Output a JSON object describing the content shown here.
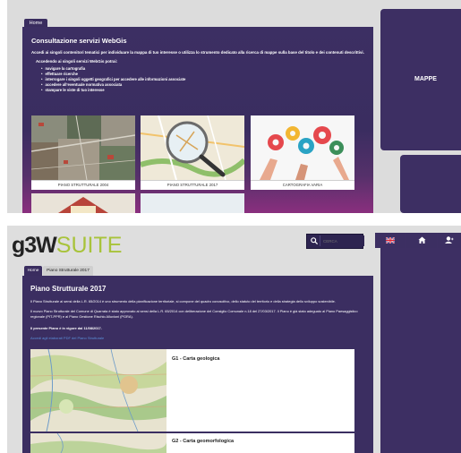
{
  "top": {
    "home_tab": "Home",
    "title": "Consultazione servizi WebGis",
    "intro": "Accedi ai singoli contenitori tematici per individuare la mappa di tuo interesse o utilizza lo strumento dedicato alla ricerca di mappe sulla base del titolo e dei contenuti descrittivi.",
    "accedendo": "Accedendo ai singoli servizi WebGis potrai:",
    "features": [
      "navigare la cartografia",
      "effettuare ricerche",
      "interrogare i singoli oggetti geografici per accedere alle informazioni associate",
      "accedere all'eventuale normativa associata",
      "stampare le viste di tuo interesse"
    ],
    "cards": [
      {
        "label": "PIANO STRUTTURALE 2004"
      },
      {
        "label": "PIANO STRUTTURALE 2017"
      },
      {
        "label": "CARTOGRAFIA VARIA"
      }
    ],
    "right_label": "MAPPE"
  },
  "bottom": {
    "logo_main": "g3W",
    "logo_suite": "SUITE",
    "search": {
      "placeholder": "CERCA"
    },
    "nav_icons": [
      "uk-flag-icon",
      "home-icon",
      "user-login-icon"
    ],
    "tabs": [
      "Home",
      "Piano Strutturale 2017"
    ],
    "title": "Piano Strutturale 2017",
    "para1": "Il Piano Strutturale ai sensi della L.R. 65/2014 è uno strumento della pianificazione territoriale, si compone del quadro conoscitivo, dello statuto del territorio e della strategia dello sviluppo sostenibile.",
    "para2": "Il nuovo Piano Strutturale del Comune di Quarrata è stato approvato ai sensi della L.R. 65/2014 con deliberazione del Consiglio Comunale n.18 del 27/03/2017. Il Piano è già stato adeguato al Piano Paesaggistico regionale (PIT-PPR) e al Piano Gestione Rischio Alluvioni (PGRA).",
    "para3": "Il presente Piano è in vigore dal 11/08/2017.",
    "link": "Accedi agli elaborati PDF del Piano Strutturale",
    "maps": [
      {
        "label": "G1 - Carta geologica"
      },
      {
        "label": "G2 - Carta geomorfologica"
      }
    ]
  },
  "colors": {
    "panel": "#3b2e61",
    "accent_green": "#a8c33a",
    "link": "#5b8fd8"
  }
}
